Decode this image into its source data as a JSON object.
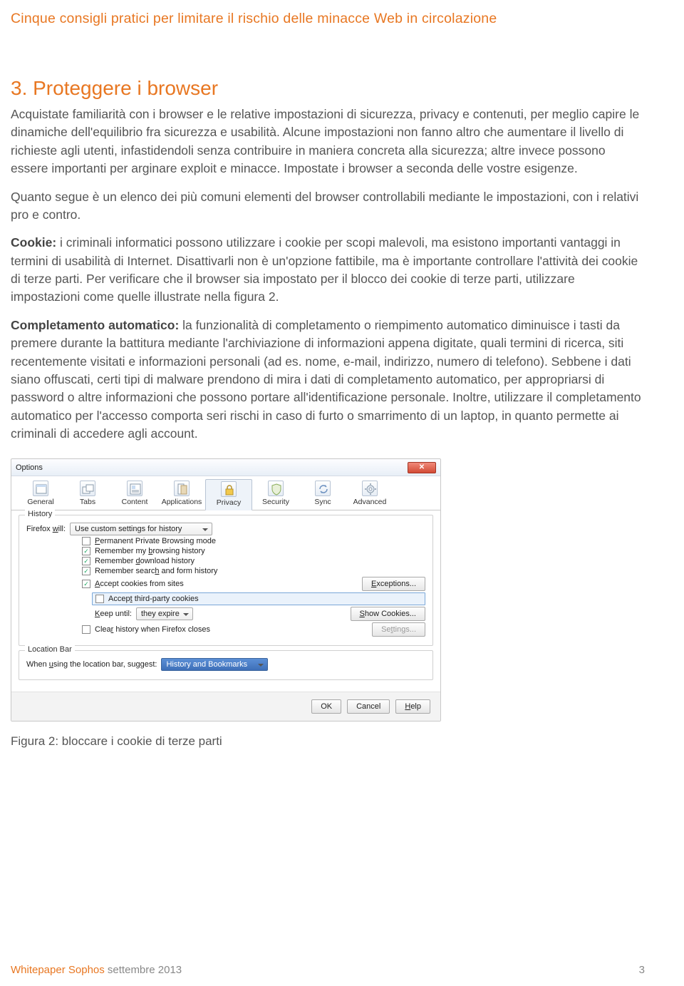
{
  "page": {
    "running_head": "Cinque consigli pratici per limitare il rischio delle minacce Web in circolazione",
    "heading": "3. Proteggere i browser",
    "p1": "Acquistate familiarità con i browser e le relative impostazioni di sicurezza, privacy e contenuti, per meglio capire le dinamiche dell'equilibrio fra sicurezza e usabilità. Alcune impostazioni non fanno altro che aumentare il livello di richieste agli utenti, infastidendoli senza contribuire in maniera concreta alla sicurezza; altre invece possono essere importanti per arginare exploit e minacce. Impostate i browser a seconda delle vostre esigenze.",
    "p2": "Quanto segue è un elenco dei più comuni elementi del browser controllabili mediante le impostazioni, con i relativi pro e contro.",
    "p3_strong": "Cookie:",
    "p3": " i criminali informatici possono utilizzare i cookie per scopi malevoli, ma esistono importanti vantaggi in termini di usabilità di Internet. Disattivarli non è un'opzione fattibile, ma è importante controllare l'attività dei cookie di terze parti. Per verificare che il browser sia impostato per il blocco dei cookie di terze parti, utilizzare impostazioni come quelle illustrate nella figura 2.",
    "p4_strong": "Completamento automatico:",
    "p4": " la funzionalità di completamento o riempimento automatico diminuisce i tasti da premere durante la battitura mediante l'archiviazione di informazioni appena digitate, quali termini di ricerca, siti recentemente visitati e informazioni personali (ad es. nome, e-mail, indirizzo, numero di telefono). Sebbene i dati siano offuscati, certi tipi di malware prendono di mira i dati di completamento automatico, per appropriarsi di password o altre informazioni che possono portare all'identificazione personale. Inoltre, utilizzare il completamento automatico per l'accesso comporta seri rischi in caso di furto o smarrimento di un laptop, in quanto permette ai criminali di accedere agli account.",
    "caption": "Figura 2: bloccare i cookie di terze parti"
  },
  "footer": {
    "brand": "Whitepaper Sophos",
    "date": "settembre 2013",
    "page_no": "3"
  },
  "dialog": {
    "title": "Options",
    "tabs": [
      "General",
      "Tabs",
      "Content",
      "Applications",
      "Privacy",
      "Security",
      "Sync",
      "Advanced"
    ],
    "active_tab_index": 4,
    "history": {
      "legend": "History",
      "firefox_will_label": "Firefox will:",
      "firefox_will_value": "Use custom settings for history",
      "perm_private": "Permanent Private Browsing mode",
      "remember_browsing": "Remember my browsing history",
      "remember_download": "Remember download history",
      "remember_search": "Remember search and form history",
      "accept_cookies": "Accept cookies from sites",
      "exceptions_btn": "Exceptions...",
      "accept_third": "Accept third-party cookies",
      "keep_until_label": "Keep until:",
      "keep_until_value": "they expire",
      "show_cookies_btn": "Show Cookies...",
      "clear_on_close": "Clear history when Firefox closes",
      "settings_btn": "Settings..."
    },
    "location": {
      "legend": "Location Bar",
      "suggest_label": "When using the location bar, suggest:",
      "suggest_value": "History and Bookmarks"
    },
    "buttons": {
      "ok": "OK",
      "cancel": "Cancel",
      "help": "Help"
    }
  }
}
